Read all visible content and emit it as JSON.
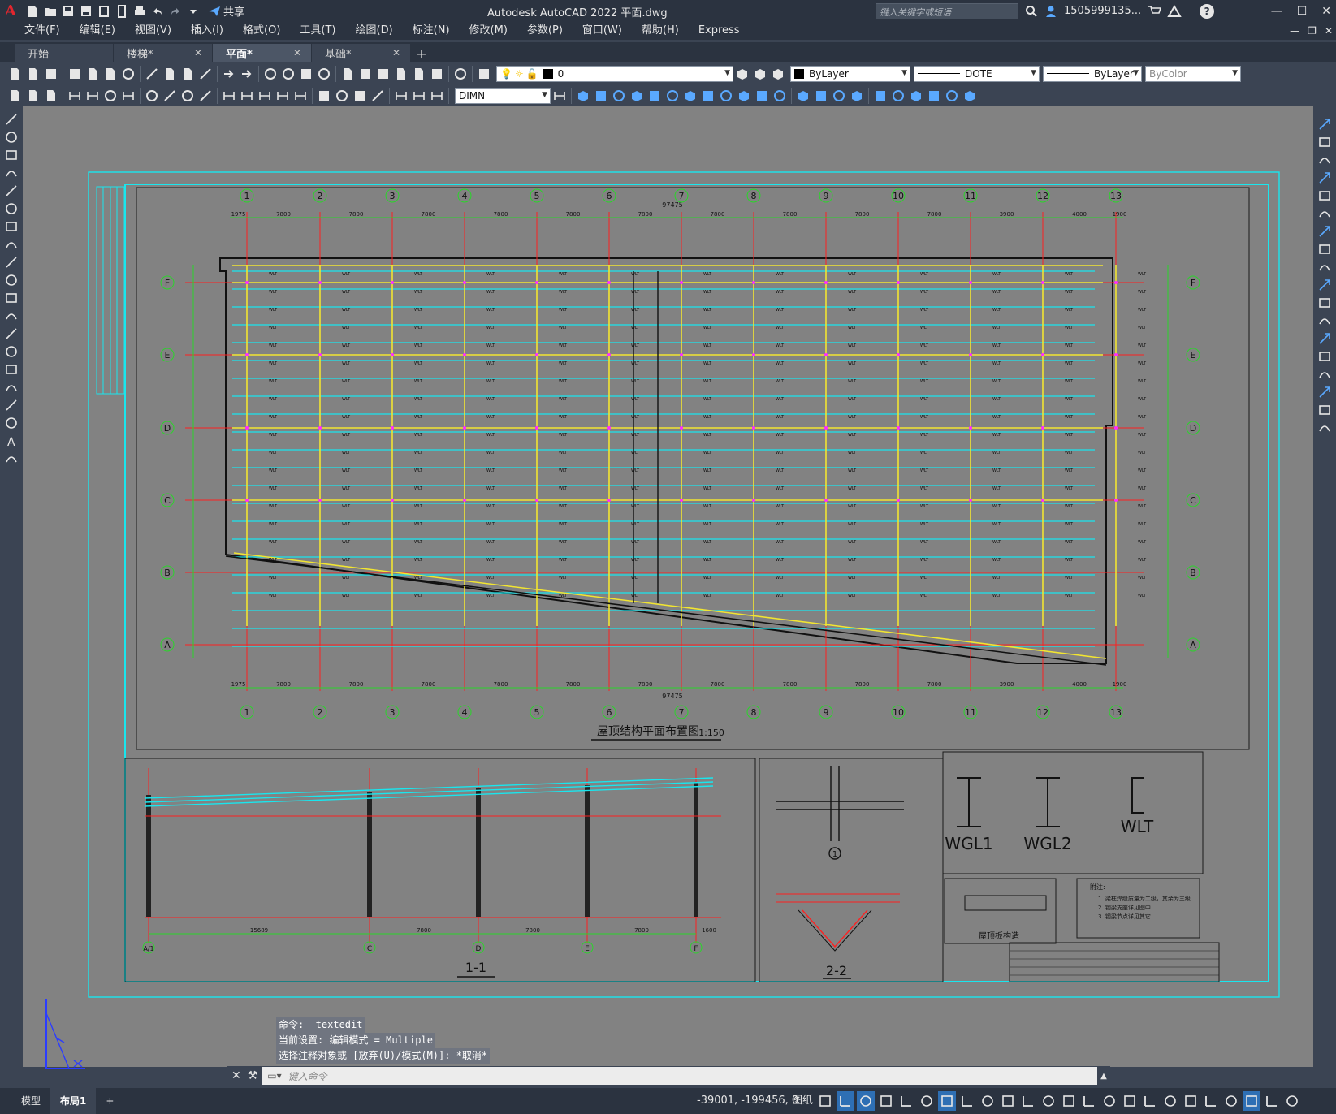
{
  "app": {
    "logo_letter": "A",
    "title": "Autodesk AutoCAD 2022    平面.dwg",
    "share_label": "共享",
    "search_placeholder": "键入关键字或短语",
    "user": "1505999135...",
    "help": "?"
  },
  "menu": [
    "文件(F)",
    "编辑(E)",
    "视图(V)",
    "插入(I)",
    "格式(O)",
    "工具(T)",
    "绘图(D)",
    "标注(N)",
    "修改(M)",
    "参数(P)",
    "窗口(W)",
    "帮助(H)",
    "Express"
  ],
  "tabs": [
    {
      "label": "开始",
      "closable": false
    },
    {
      "label": "楼梯*",
      "closable": true
    },
    {
      "label": "平面*",
      "closable": true,
      "active": true
    },
    {
      "label": "基础*",
      "closable": true
    }
  ],
  "toolbar1": {
    "layer_value": "0",
    "color_value": "ByLayer",
    "linetype_value": "DOTE",
    "lineweight_value": "ByLayer",
    "plotstyle_value": "ByColor"
  },
  "toolbar2": {
    "dimstyle_value": "DIMN"
  },
  "drawing": {
    "title": "屋顶结构平面布置图",
    "scale": "1:150",
    "overall_dim": "97475",
    "grid_cols": [
      "1",
      "2",
      "3",
      "4",
      "5",
      "6",
      "7",
      "8",
      "9",
      "10",
      "11",
      "12",
      "13"
    ],
    "grid_rows": [
      "F",
      "E",
      "D",
      "C",
      "B",
      "A"
    ],
    "top_spacings": [
      "1975",
      "7800",
      "7800",
      "7800",
      "7800",
      "7800",
      "7800",
      "7800",
      "7800",
      "7800",
      "7800",
      "3900",
      "4000",
      "1900"
    ],
    "section_1_label": "1-1",
    "section_2_label": "2-2",
    "section_1_axes": [
      "C",
      "D",
      "E",
      "F"
    ],
    "section_1_dims": [
      "15689",
      "7800",
      "7800",
      "7800",
      "1600"
    ],
    "profile_labels": [
      "WGL1",
      "WGL2",
      "WLT"
    ],
    "roof_board_label": "屋顶板构造",
    "notes_title": "附注:",
    "notes": [
      "1. 梁柱焊缝质量为二级，其余为三级",
      "2. 钢梁支座详见图中",
      "3. 钢梁节点详见其它"
    ]
  },
  "command": {
    "history": [
      "命令: _textedit",
      "当前设置: 编辑模式 = Multiple",
      "选择注释对象或 [放弃(U)/模式(M)]: *取消*"
    ],
    "placeholder": "键入命令"
  },
  "status": {
    "model_tab": "模型",
    "layout_tab": "布局1",
    "coords": "-39001, -199456, 0",
    "paper": "图纸"
  },
  "colors": {
    "canvas_bg": "#828282",
    "grid_red": "#ff2020",
    "beam_cyan": "#19e6ee",
    "beam_yellow": "#f2e531",
    "dim_green": "#2bd42b",
    "frame_cyan": "#19e6ee",
    "node_magenta": "#ff2cff"
  }
}
